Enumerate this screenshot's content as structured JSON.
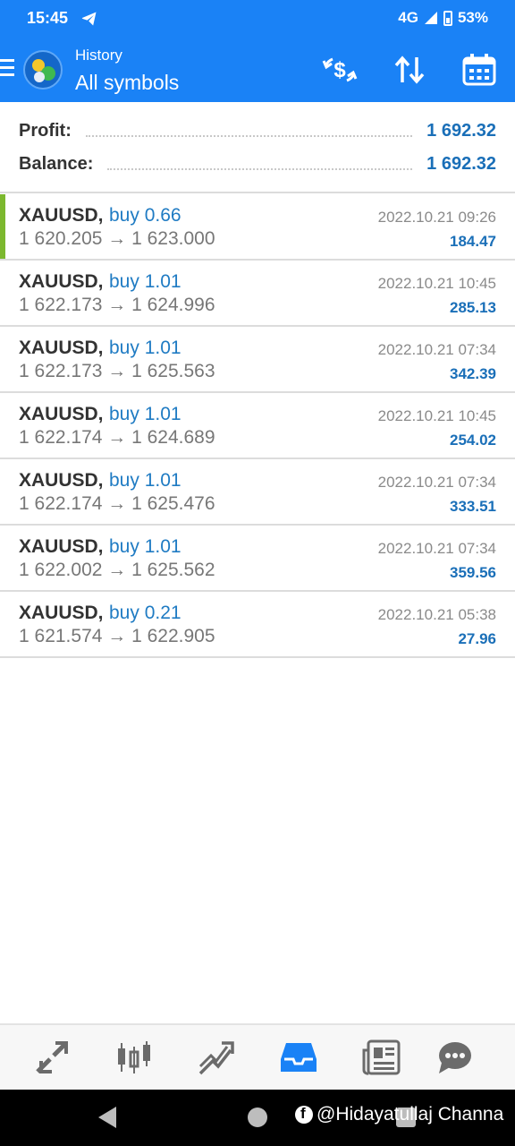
{
  "status_bar": {
    "time": "15:45",
    "network": "4G",
    "battery": "53%"
  },
  "header": {
    "subtitle": "History",
    "title": "All symbols",
    "icons": [
      "menu-icon",
      "app-logo",
      "currency-exchange-icon",
      "sort-icon",
      "calendar-icon"
    ]
  },
  "summary": {
    "profit_label": "Profit:",
    "profit_value": "1 692.32",
    "balance_label": "Balance:",
    "balance_value": "1 692.32"
  },
  "trades": [
    {
      "symbol": "XAUUSD,",
      "side": "buy 0.66",
      "prices": "1 620.205 → 1 623.000",
      "time": "2022.10.21 09:26",
      "profit": "184.47"
    },
    {
      "symbol": "XAUUSD,",
      "side": "buy 1.01",
      "prices": "1 622.173 → 1 624.996",
      "time": "2022.10.21 10:45",
      "profit": "285.13"
    },
    {
      "symbol": "XAUUSD,",
      "side": "buy 1.01",
      "prices": "1 622.173 → 1 625.563",
      "time": "2022.10.21 07:34",
      "profit": "342.39"
    },
    {
      "symbol": "XAUUSD,",
      "side": "buy 1.01",
      "prices": "1 622.174 → 1 624.689",
      "time": "2022.10.21 10:45",
      "profit": "254.02"
    },
    {
      "symbol": "XAUUSD,",
      "side": "buy 1.01",
      "prices": "1 622.174 → 1 625.476",
      "time": "2022.10.21 07:34",
      "profit": "333.51"
    },
    {
      "symbol": "XAUUSD,",
      "side": "buy 1.01",
      "prices": "1 622.002 → 1 625.562",
      "time": "2022.10.21 07:34",
      "profit": "359.56"
    },
    {
      "symbol": "XAUUSD,",
      "side": "buy 0.21",
      "prices": "1 621.574 → 1 622.905",
      "time": "2022.10.21 05:38",
      "profit": "27.96"
    }
  ],
  "bottom_nav": {
    "items": [
      "quotes-icon",
      "chart-icon",
      "trade-icon",
      "history-icon",
      "news-icon",
      "chat-icon"
    ],
    "active": "history-icon"
  },
  "watermark": "@Hidayatullaj Channa",
  "colors": {
    "header_bg": "#1a82f6",
    "accent_blue": "#1f7bc3",
    "active_nav": "#1a82f6",
    "selection_bar": "#7cb82f"
  }
}
